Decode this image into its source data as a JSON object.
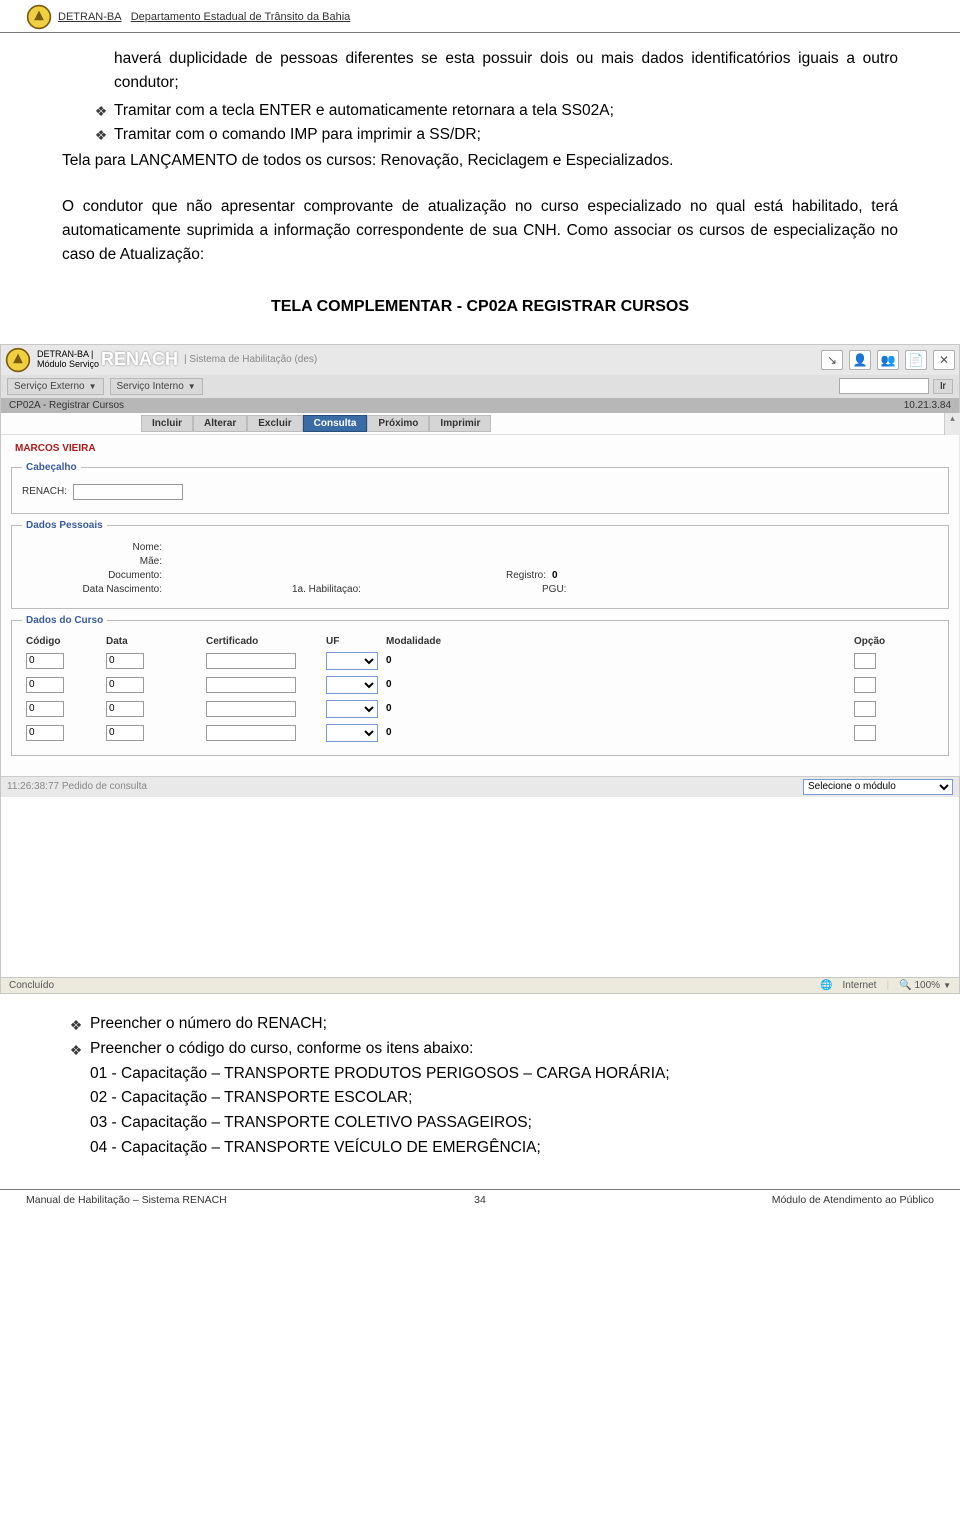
{
  "header": {
    "org": "DETRAN-BA",
    "dept": "Departamento Estadual de Trânsito da Bahia"
  },
  "para1": "haverá duplicidade de pessoas diferentes se esta possuir dois ou mais dados identificatórios iguais a outro condutor;",
  "bul1": "Tramitar com a tecla ENTER e automaticamente retornara a tela SS02A;",
  "bul2": "Tramitar com o comando IMP para imprimir a SS/DR;",
  "para2": "Tela para LANÇAMENTO de todos os cursos: Renovação, Reciclagem e Especializados.",
  "para3": "O condutor que não apresentar comprovante de atualização no curso especializado no qual está habilitado, terá automaticamente suprimida a informação correspondente de sua CNH. Como associar os cursos de especialização no caso de Atualização:",
  "sectionTitle": "TELA COMPLEMENTAR - CP02A REGISTRAR CURSOS",
  "app": {
    "brandTop": "DETRAN-BA |",
    "brandBot": "Módulo Serviço",
    "renach": "RENACH",
    "sist": "| Sistema de Habilitação (des)",
    "menuExt": "Serviço Externo",
    "menuInt": "Serviço Interno",
    "goLabel": "Ir",
    "crumb": "CP02A - Registrar Cursos",
    "version": "10.21.3.84",
    "actions": {
      "incluir": "Incluir",
      "alterar": "Alterar",
      "excluir": "Excluir",
      "consulta": "Consulta",
      "proximo": "Próximo",
      "imprimir": "Imprimir"
    },
    "user": "MARCOS VIEIRA",
    "fs1": "Cabeçalho",
    "renachLbl": "RENACH:",
    "fs2": "Dados Pessoais",
    "lblNome": "Nome:",
    "lblMae": "Mãe:",
    "lblDoc": "Documento:",
    "lblReg": "Registro:",
    "valReg": "0",
    "lblNasc": "Data Nascimento:",
    "lblHab": "1a. Habilitaçao:",
    "lblPgu": "PGU:",
    "fs3": "Dados do Curso",
    "hCod": "Código",
    "hData": "Data",
    "hCert": "Certificado",
    "hUF": "UF",
    "hMod": "Modalidade",
    "hOpc": "Opção",
    "rows": [
      {
        "cod": "0",
        "data": "0",
        "cert": "",
        "mod": "0"
      },
      {
        "cod": "0",
        "data": "0",
        "cert": "",
        "mod": "0"
      },
      {
        "cod": "0",
        "data": "0",
        "cert": "",
        "mod": "0"
      },
      {
        "cod": "0",
        "data": "0",
        "cert": "",
        "mod": "0"
      }
    ],
    "status": "11:26:38:77 Pedido de consulta",
    "modSel": "Selecione o módulo",
    "bfLeft": "Concluído",
    "bfNet": "Internet",
    "bfZoom": "100%"
  },
  "after": {
    "b1": "Preencher o número do RENACH;",
    "b2": "Preencher o código do curso, conforme os itens abaixo:",
    "i1": "01 - Capacitação – TRANSPORTE PRODUTOS PERIGOSOS – CARGA HORÁRIA;",
    "i2": "02 - Capacitação – TRANSPORTE ESCOLAR;",
    "i3": "03 - Capacitação – TRANSPORTE COLETIVO PASSAGEIROS;",
    "i4": "04 - Capacitação – TRANSPORTE VEÍCULO DE EMERGÊNCIA;"
  },
  "footer": {
    "left": "Manual de Habilitação – Sistema RENACH",
    "page": "34",
    "right": "Módulo de Atendimento ao Público"
  },
  "glyph": {
    "diamond": "❖"
  }
}
